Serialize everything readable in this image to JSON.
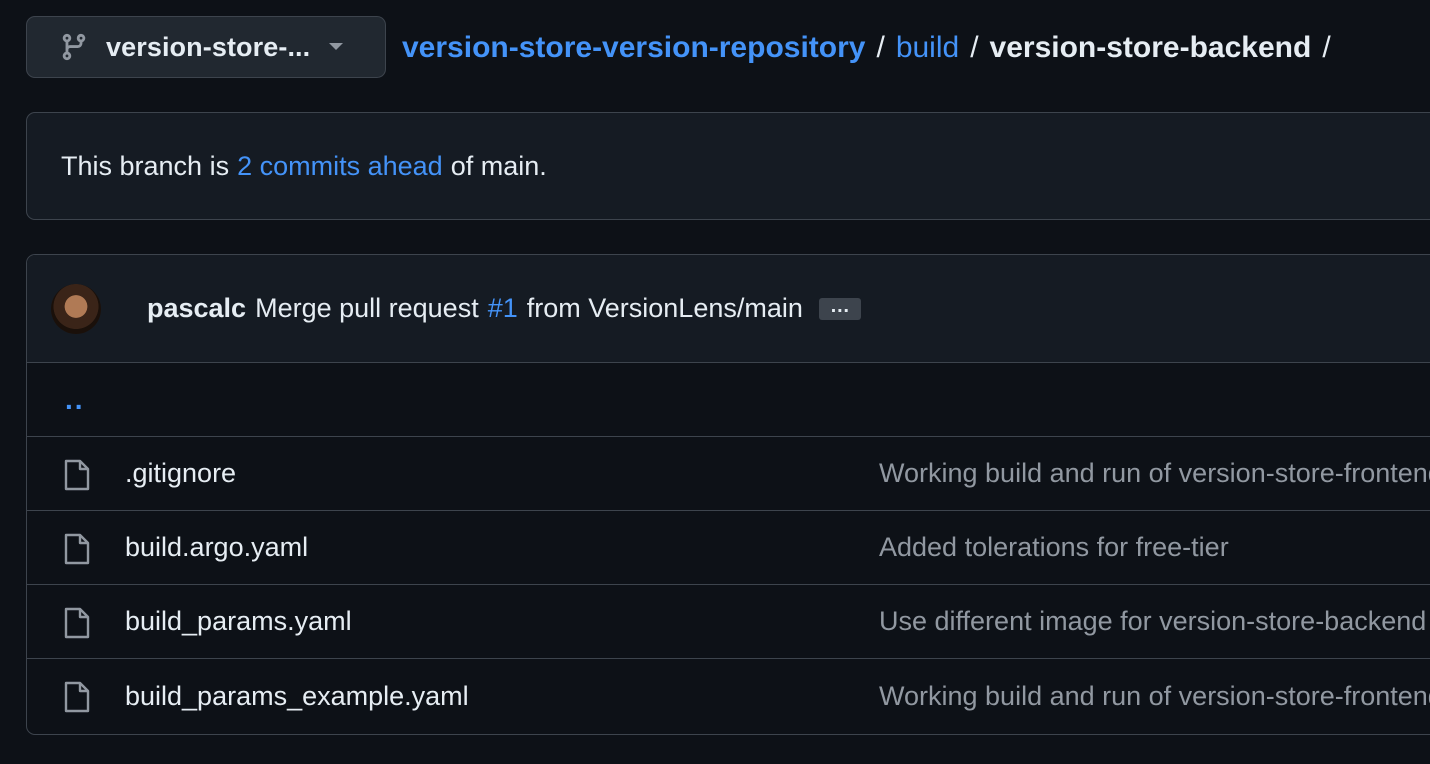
{
  "header": {
    "branch_selector": {
      "label": "version-store-...",
      "icon": "git-branch-icon",
      "caret_icon": "triangle-down-icon"
    },
    "breadcrumb": {
      "repo": "version-store-version-repository",
      "sep1": "/",
      "folder": "build",
      "sep2": "/",
      "current": "version-store-backend",
      "sep3": "/"
    }
  },
  "ahead_notice": {
    "prefix": "This branch is",
    "link": "2 commits ahead",
    "suffix": "of main."
  },
  "latest_commit": {
    "author": "pascalc",
    "message_start": "Merge pull request",
    "pr_link": "#1",
    "message_end": "from VersionLens/main",
    "ellipsis": "…"
  },
  "parent_dir": "..",
  "files": [
    {
      "name": ".gitignore",
      "commit": "Working build and run of version-store-frontend",
      "icon": "file-icon"
    },
    {
      "name": "build.argo.yaml",
      "commit": "Added tolerations for free-tier",
      "icon": "file-icon"
    },
    {
      "name": "build_params.yaml",
      "commit": "Use different image for version-store-backend",
      "icon": "file-icon"
    },
    {
      "name": "build_params_example.yaml",
      "commit": "Working build and run of version-store-frontend",
      "icon": "file-icon"
    }
  ],
  "colors": {
    "background": "#0d1117",
    "link": "#4493f8",
    "text": "#e6edf3",
    "muted": "#9198a1",
    "border": "#3d444d"
  }
}
